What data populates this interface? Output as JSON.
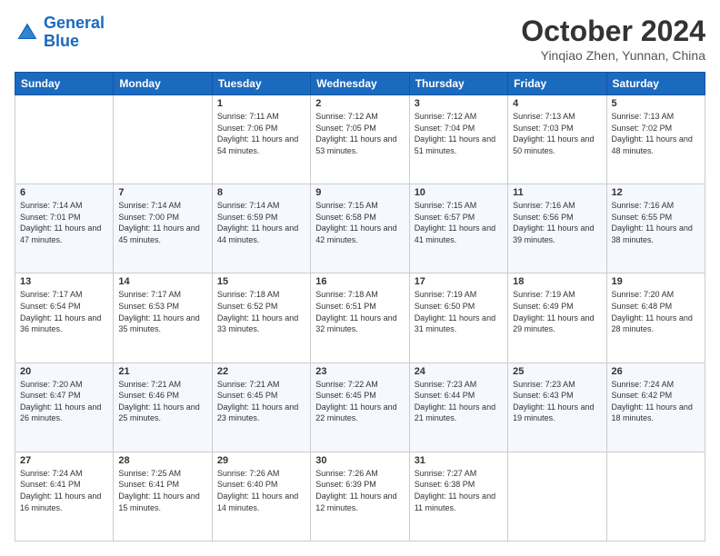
{
  "logo": {
    "text_general": "General",
    "text_blue": "Blue"
  },
  "header": {
    "title": "October 2024",
    "subtitle": "Yinqiao Zhen, Yunnan, China"
  },
  "weekdays": [
    "Sunday",
    "Monday",
    "Tuesday",
    "Wednesday",
    "Thursday",
    "Friday",
    "Saturday"
  ],
  "weeks": [
    [
      {
        "day": "",
        "info": ""
      },
      {
        "day": "",
        "info": ""
      },
      {
        "day": "1",
        "info": "Sunrise: 7:11 AM\nSunset: 7:06 PM\nDaylight: 11 hours and 54 minutes."
      },
      {
        "day": "2",
        "info": "Sunrise: 7:12 AM\nSunset: 7:05 PM\nDaylight: 11 hours and 53 minutes."
      },
      {
        "day": "3",
        "info": "Sunrise: 7:12 AM\nSunset: 7:04 PM\nDaylight: 11 hours and 51 minutes."
      },
      {
        "day": "4",
        "info": "Sunrise: 7:13 AM\nSunset: 7:03 PM\nDaylight: 11 hours and 50 minutes."
      },
      {
        "day": "5",
        "info": "Sunrise: 7:13 AM\nSunset: 7:02 PM\nDaylight: 11 hours and 48 minutes."
      }
    ],
    [
      {
        "day": "6",
        "info": "Sunrise: 7:14 AM\nSunset: 7:01 PM\nDaylight: 11 hours and 47 minutes."
      },
      {
        "day": "7",
        "info": "Sunrise: 7:14 AM\nSunset: 7:00 PM\nDaylight: 11 hours and 45 minutes."
      },
      {
        "day": "8",
        "info": "Sunrise: 7:14 AM\nSunset: 6:59 PM\nDaylight: 11 hours and 44 minutes."
      },
      {
        "day": "9",
        "info": "Sunrise: 7:15 AM\nSunset: 6:58 PM\nDaylight: 11 hours and 42 minutes."
      },
      {
        "day": "10",
        "info": "Sunrise: 7:15 AM\nSunset: 6:57 PM\nDaylight: 11 hours and 41 minutes."
      },
      {
        "day": "11",
        "info": "Sunrise: 7:16 AM\nSunset: 6:56 PM\nDaylight: 11 hours and 39 minutes."
      },
      {
        "day": "12",
        "info": "Sunrise: 7:16 AM\nSunset: 6:55 PM\nDaylight: 11 hours and 38 minutes."
      }
    ],
    [
      {
        "day": "13",
        "info": "Sunrise: 7:17 AM\nSunset: 6:54 PM\nDaylight: 11 hours and 36 minutes."
      },
      {
        "day": "14",
        "info": "Sunrise: 7:17 AM\nSunset: 6:53 PM\nDaylight: 11 hours and 35 minutes."
      },
      {
        "day": "15",
        "info": "Sunrise: 7:18 AM\nSunset: 6:52 PM\nDaylight: 11 hours and 33 minutes."
      },
      {
        "day": "16",
        "info": "Sunrise: 7:18 AM\nSunset: 6:51 PM\nDaylight: 11 hours and 32 minutes."
      },
      {
        "day": "17",
        "info": "Sunrise: 7:19 AM\nSunset: 6:50 PM\nDaylight: 11 hours and 31 minutes."
      },
      {
        "day": "18",
        "info": "Sunrise: 7:19 AM\nSunset: 6:49 PM\nDaylight: 11 hours and 29 minutes."
      },
      {
        "day": "19",
        "info": "Sunrise: 7:20 AM\nSunset: 6:48 PM\nDaylight: 11 hours and 28 minutes."
      }
    ],
    [
      {
        "day": "20",
        "info": "Sunrise: 7:20 AM\nSunset: 6:47 PM\nDaylight: 11 hours and 26 minutes."
      },
      {
        "day": "21",
        "info": "Sunrise: 7:21 AM\nSunset: 6:46 PM\nDaylight: 11 hours and 25 minutes."
      },
      {
        "day": "22",
        "info": "Sunrise: 7:21 AM\nSunset: 6:45 PM\nDaylight: 11 hours and 23 minutes."
      },
      {
        "day": "23",
        "info": "Sunrise: 7:22 AM\nSunset: 6:45 PM\nDaylight: 11 hours and 22 minutes."
      },
      {
        "day": "24",
        "info": "Sunrise: 7:23 AM\nSunset: 6:44 PM\nDaylight: 11 hours and 21 minutes."
      },
      {
        "day": "25",
        "info": "Sunrise: 7:23 AM\nSunset: 6:43 PM\nDaylight: 11 hours and 19 minutes."
      },
      {
        "day": "26",
        "info": "Sunrise: 7:24 AM\nSunset: 6:42 PM\nDaylight: 11 hours and 18 minutes."
      }
    ],
    [
      {
        "day": "27",
        "info": "Sunrise: 7:24 AM\nSunset: 6:41 PM\nDaylight: 11 hours and 16 minutes."
      },
      {
        "day": "28",
        "info": "Sunrise: 7:25 AM\nSunset: 6:41 PM\nDaylight: 11 hours and 15 minutes."
      },
      {
        "day": "29",
        "info": "Sunrise: 7:26 AM\nSunset: 6:40 PM\nDaylight: 11 hours and 14 minutes."
      },
      {
        "day": "30",
        "info": "Sunrise: 7:26 AM\nSunset: 6:39 PM\nDaylight: 11 hours and 12 minutes."
      },
      {
        "day": "31",
        "info": "Sunrise: 7:27 AM\nSunset: 6:38 PM\nDaylight: 11 hours and 11 minutes."
      },
      {
        "day": "",
        "info": ""
      },
      {
        "day": "",
        "info": ""
      }
    ]
  ]
}
